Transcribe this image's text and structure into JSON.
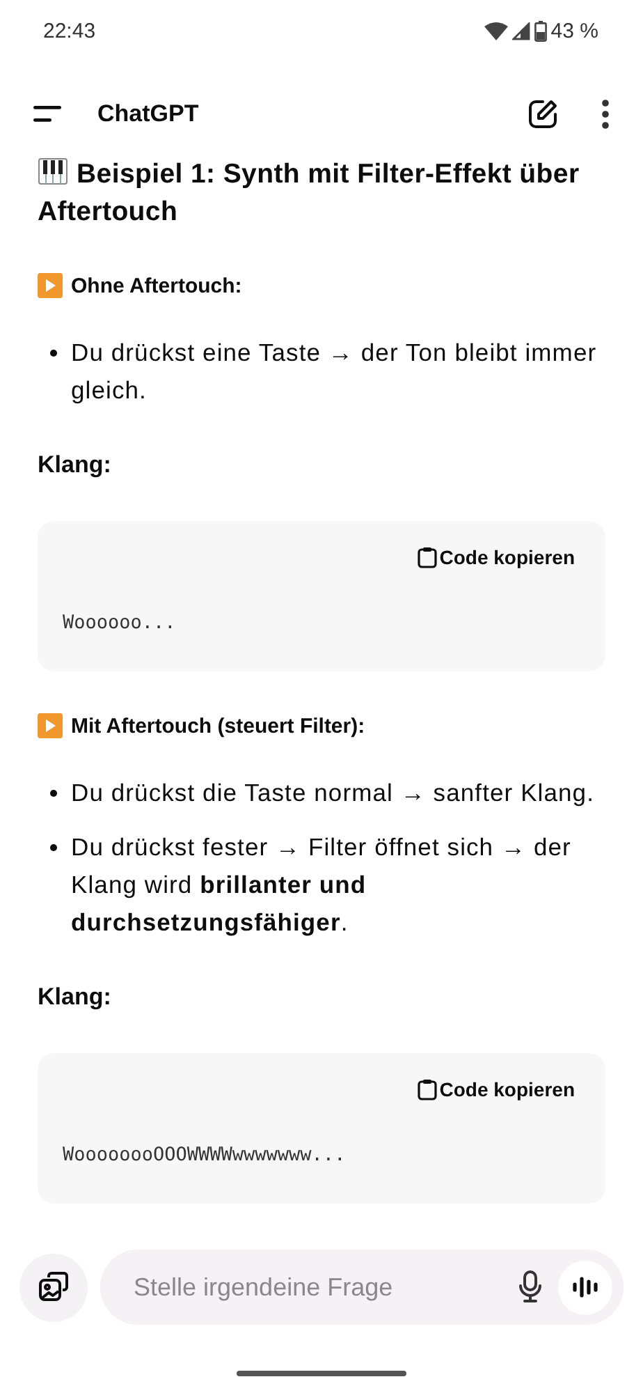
{
  "status_bar": {
    "time": "22:43",
    "battery": "43 %"
  },
  "header": {
    "title": "ChatGPT"
  },
  "content": [
    {
      "kind": "heading",
      "text": "Beispiel 1: Synth mit Filter-Effekt über Aftertouch"
    },
    {
      "kind": "subheading",
      "text": "Ohne Aftertouch:"
    },
    {
      "kind": "bullets",
      "items": [
        "Du drückst eine Taste → der Ton bleibt immer gleich."
      ]
    },
    {
      "kind": "label",
      "text": "Klang:"
    },
    {
      "kind": "code",
      "button": "Code kopieren",
      "code": "Woooooo..."
    },
    {
      "kind": "subheading",
      "text": "Mit Aftertouch (steuert Filter):"
    },
    {
      "kind": "bullets",
      "items": [
        "Du drückst die Taste normal → sanfter Klang.",
        "Du drückst fester → Filter öffnet sich → der Klang wird **brillanter und durchsetzungsfähiger**."
      ]
    },
    {
      "kind": "label",
      "text": "Klang:"
    },
    {
      "kind": "code",
      "button": "Code kopieren",
      "code": "WoooooooOOOWWWWwwwwwww..."
    }
  ],
  "composer": {
    "placeholder": "Stelle irgendeine Frage"
  }
}
